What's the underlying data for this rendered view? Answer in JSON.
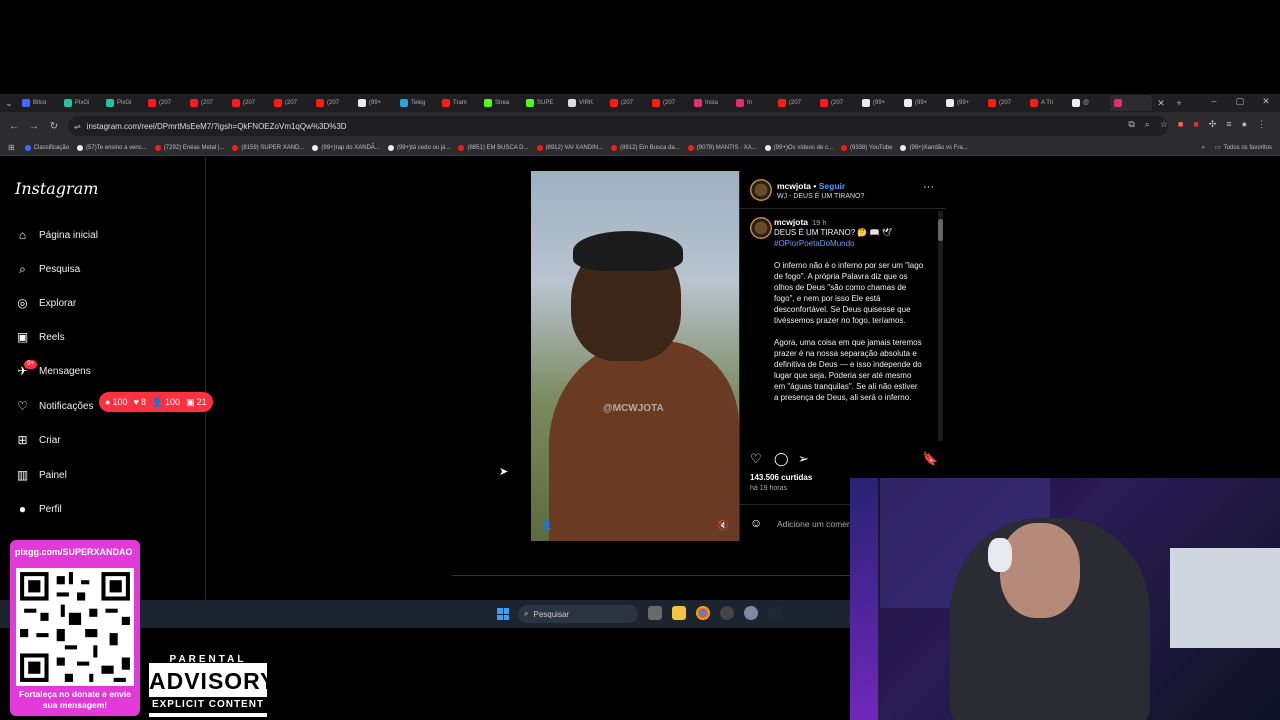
{
  "browser": {
    "tabs": [
      {
        "label": "Bitco",
        "color": "#3b6cff"
      },
      {
        "label": "PixGi",
        "color": "#27c3a0"
      },
      {
        "label": "PixGi",
        "color": "#27c3a0"
      },
      {
        "label": "(207",
        "color": "#ff1a1a"
      },
      {
        "label": "(207",
        "color": "#ff1a1a"
      },
      {
        "label": "(207",
        "color": "#ff1a1a"
      },
      {
        "label": "(207",
        "color": "#ff1a1a"
      },
      {
        "label": "(207",
        "color": "#ff1a1a"
      },
      {
        "label": "(99+",
        "color": "#eeeeee"
      },
      {
        "label": "Teleg",
        "color": "#2aa3e0"
      },
      {
        "label": "Tram",
        "color": "#ff1a1a"
      },
      {
        "label": "Strea",
        "color": "#53fc18"
      },
      {
        "label": "SUPE",
        "color": "#53fc18"
      },
      {
        "label": "VIRK",
        "color": "#dddddd"
      },
      {
        "label": "(207",
        "color": "#ff1a1a"
      },
      {
        "label": "(207",
        "color": "#ff1a1a"
      },
      {
        "label": "Insta",
        "color": "#e1306c"
      },
      {
        "label": "In",
        "color": "#e1306c"
      },
      {
        "label": "(207",
        "color": "#ff1a1a"
      },
      {
        "label": "(207",
        "color": "#ff1a1a"
      },
      {
        "label": "(99+",
        "color": "#eeeeee"
      },
      {
        "label": "(99+",
        "color": "#eeeeee"
      },
      {
        "label": "(99+",
        "color": "#eeeeee"
      },
      {
        "label": "(207",
        "color": "#ff1a1a"
      },
      {
        "label": "A Tri",
        "color": "#ff1a1a"
      },
      {
        "label": "@",
        "color": "#eeeeee"
      },
      {
        "label": "",
        "color": "#e1306c"
      }
    ],
    "close_tab_label": "✕",
    "new_tab_label": "+",
    "url": "instagram.com/reel/DPmrtMsEeM7/?igsh=QkFNOEZoVm1qQw%3D%3D",
    "bookmarks": [
      {
        "label": "Classificação",
        "color": "#3b6cff"
      },
      {
        "label": "(57)Te ensino a venc...",
        "color": "#eeeeee"
      },
      {
        "label": "(7292) Enéas Metal |...",
        "color": "#ff1a1a"
      },
      {
        "label": "(8159) SUPER XAND...",
        "color": "#ff1a1a"
      },
      {
        "label": "(99+)rap do XANDÃ...",
        "color": "#eeeeee"
      },
      {
        "label": "(99+)tá cedo ou já...",
        "color": "#eeeeee"
      },
      {
        "label": "(8851) EM BUSCA D...",
        "color": "#ff1a1a"
      },
      {
        "label": "(8912) VAI XANDIN...",
        "color": "#ff1a1a"
      },
      {
        "label": "(8912) Em Busca da...",
        "color": "#ff1a1a"
      },
      {
        "label": "(9078) MANTIS - XA...",
        "color": "#ff1a1a"
      },
      {
        "label": "(99+)Os vídeos de c...",
        "color": "#eeeeee"
      },
      {
        "label": "(9338) YouTube",
        "color": "#ff1a1a"
      },
      {
        "label": "(99+)Xandão vs Fra...",
        "color": "#eeeeee"
      }
    ],
    "all_favorites": "Todos os favoritos"
  },
  "instagram": {
    "logo": "Instagram",
    "nav": [
      {
        "label": "Página inicial",
        "icon": "⌂"
      },
      {
        "label": "Pesquisa",
        "icon": "⌕"
      },
      {
        "label": "Explorar",
        "icon": "◎"
      },
      {
        "label": "Reels",
        "icon": "▣"
      },
      {
        "label": "Mensagens",
        "icon": "✈"
      },
      {
        "label": "Notificações",
        "icon": "♡"
      },
      {
        "label": "Criar",
        "icon": "⊞"
      },
      {
        "label": "Painel",
        "icon": "▥"
      },
      {
        "label": "Perfil",
        "icon": "●"
      }
    ],
    "messages_badge": "9+",
    "notif_counts": {
      "comments": "100",
      "likes": "8",
      "follows": "100",
      "tags": "21"
    },
    "post": {
      "watermark": "@MCWJOTA",
      "username": "mcwjota",
      "separator": "•",
      "follow": "Seguir",
      "subtitle": "WJ - DEUS É UM TIRANO?",
      "more": "···",
      "time": "19 h",
      "caption_title": "DEUS É UM TIRANO? 🤔 📖 🕊",
      "hashtag": "#OPiorPoetaDoMundo",
      "caption_body": "O inferno não é o inferno por ser um \"lago de fogo\". A própria Palavra diz que os olhos de Deus \"são como chamas de fogo\", e nem por isso Ele está desconfortável. Se Deus quisesse que tivéssemos prazer no fogo, teríamos.\n\nAgora, uma coisa em que jamais teremos prazer é na nossa separação absoluta e definitiva de Deus — e isso independe do lugar que seja. Poderia ser até mesmo em \"águas tranquilas\". Se ali não estiver a presença de Deus, ali será o inferno.",
      "likes": "143.506 curtidas",
      "posted_ago": "há 19 horas",
      "add_comment": "Adicione um comentário..."
    }
  },
  "taskbar": {
    "search": "Pesquisar"
  },
  "overlay": {
    "donate_url": "pixgg.com/SUPERXANDAO",
    "donate_msg": "Fortaleça no donate e envie sua mensagem!",
    "advisory_top": "PARENTAL",
    "advisory_mid": "ADVISORY",
    "advisory_bottom": "EXPLICIT CONTENT"
  }
}
